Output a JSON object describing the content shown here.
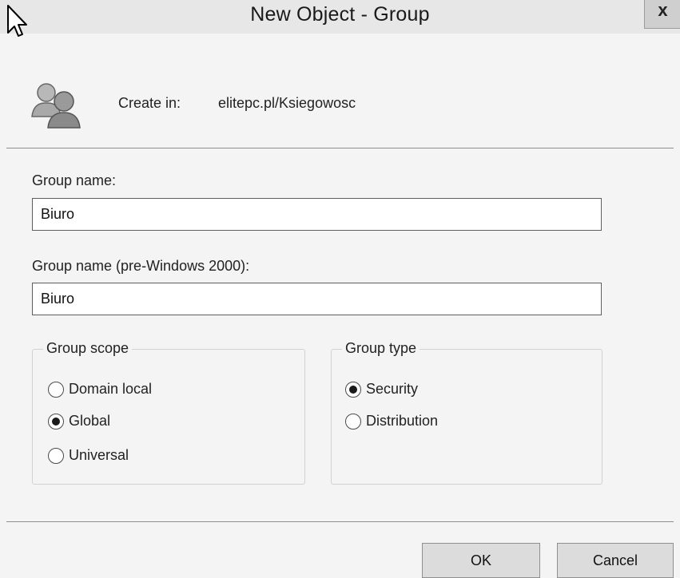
{
  "window": {
    "title": "New Object - Group",
    "close_glyph": "x"
  },
  "header": {
    "icon": "users-group-icon",
    "create_in_label": "Create in:",
    "create_in_value": "elitepc.pl/Ksiegowosc"
  },
  "fields": {
    "group_name": {
      "label": "Group name:",
      "value": "Biuro"
    },
    "group_name_pre2000": {
      "label": "Group name (pre-Windows 2000):",
      "value": "Biuro"
    }
  },
  "group_scope": {
    "title": "Group scope",
    "options": [
      {
        "label": "Domain local",
        "checked": false
      },
      {
        "label": "Global",
        "checked": true
      },
      {
        "label": "Universal",
        "checked": false
      }
    ]
  },
  "group_type": {
    "title": "Group type",
    "options": [
      {
        "label": "Security",
        "checked": true
      },
      {
        "label": "Distribution",
        "checked": false
      }
    ]
  },
  "buttons": {
    "ok": "OK",
    "cancel": "Cancel"
  },
  "colors": {
    "window_bg": "#f4f4f4",
    "titlebar_bg": "#e7e7e7",
    "button_bg": "#dcdcdc"
  }
}
